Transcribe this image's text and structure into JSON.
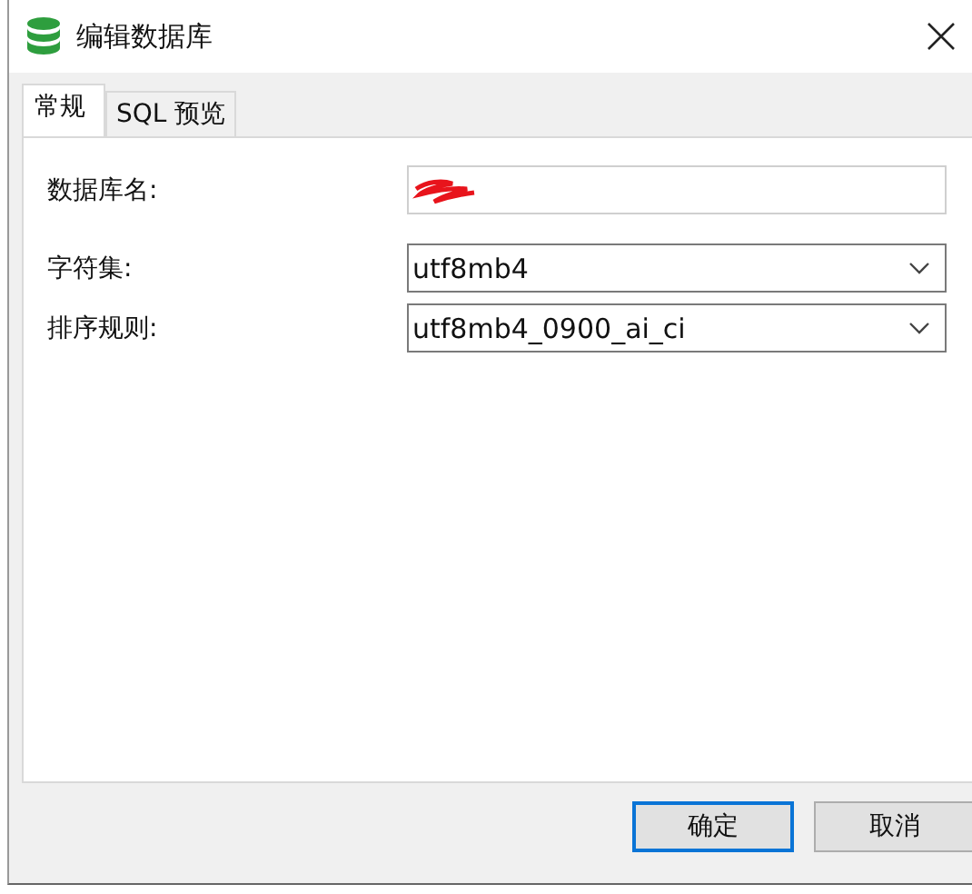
{
  "window": {
    "title": "编辑数据库"
  },
  "tabs": [
    {
      "label": "常规",
      "selected": true
    },
    {
      "label": "SQL 预览",
      "selected": false
    }
  ],
  "fields": [
    {
      "kind": "text",
      "label": "数据库名:",
      "redacted": true
    },
    {
      "kind": "select",
      "label": "字符集:",
      "value": "utf8mb4"
    },
    {
      "kind": "select",
      "label": "排序规则:",
      "value": "utf8mb4_0900_ai_ci"
    }
  ],
  "buttons": [
    {
      "label": "确定",
      "default": true
    },
    {
      "label": "取消",
      "default": false
    }
  ]
}
